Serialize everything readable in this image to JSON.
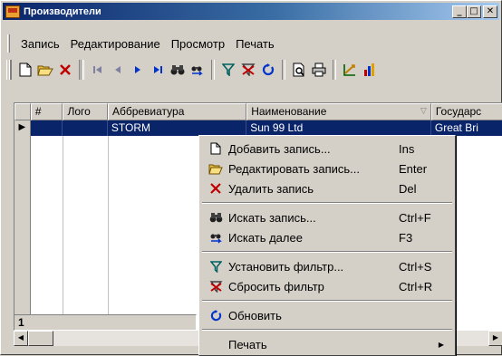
{
  "window": {
    "title": "Производители",
    "minimize": "_",
    "maximize": "□",
    "close": "✕"
  },
  "menubar": {
    "items": [
      "Запись",
      "Редактирование",
      "Просмотр",
      "Печать"
    ]
  },
  "toolbar": {
    "new": "🗋",
    "edit": "📂",
    "delete": "✕",
    "first": "⏮",
    "prev": "◀",
    "next": "▶",
    "last": "⏭",
    "find": "🔍",
    "find_next": "🔎",
    "filter": "⛛",
    "clear_filter": "⛛",
    "refresh": "↻",
    "preview": "🔎",
    "print": "🖶",
    "export": "📐",
    "chart": "📊"
  },
  "grid": {
    "columns": [
      "#",
      "Лого",
      "Аббревиатура",
      "Наименование",
      "Государс"
    ],
    "sort_indicator": "▽",
    "rows": [
      {
        "indicator": "▶",
        "num": "",
        "logo": "",
        "abbr": "STORM",
        "name": "Sun 99 Ltd",
        "state": "Great Bri"
      }
    ]
  },
  "status": {
    "record": "1"
  },
  "scrollbar": {
    "left": "◀",
    "right": "▶"
  },
  "context_menu": {
    "items": [
      {
        "label": "Добавить запись...",
        "shortcut": "Ins",
        "icon": "new-record-icon"
      },
      {
        "label": "Редактировать запись...",
        "shortcut": "Enter",
        "icon": "edit-record-icon"
      },
      {
        "label": "Удалить запись",
        "shortcut": "Del",
        "icon": "delete-icon"
      },
      {
        "label": "Искать запись...",
        "shortcut": "Ctrl+F",
        "icon": "binoculars-icon"
      },
      {
        "label": "Искать далее",
        "shortcut": "F3",
        "icon": "find-next-icon"
      },
      {
        "label": "Установить фильтр...",
        "shortcut": "Ctrl+S",
        "icon": "filter-icon"
      },
      {
        "label": "Сбросить фильтр",
        "shortcut": "Ctrl+R",
        "icon": "clear-filter-icon"
      },
      {
        "label": "Обновить",
        "shortcut": "",
        "icon": "refresh-icon"
      },
      {
        "label": "Печать",
        "shortcut": "",
        "icon": "",
        "submenu": true
      }
    ]
  },
  "colors": {
    "selection": "#0a246a",
    "face": "#d4d0c8",
    "delete_red": "#c00000",
    "refresh_blue": "#0033cc"
  }
}
